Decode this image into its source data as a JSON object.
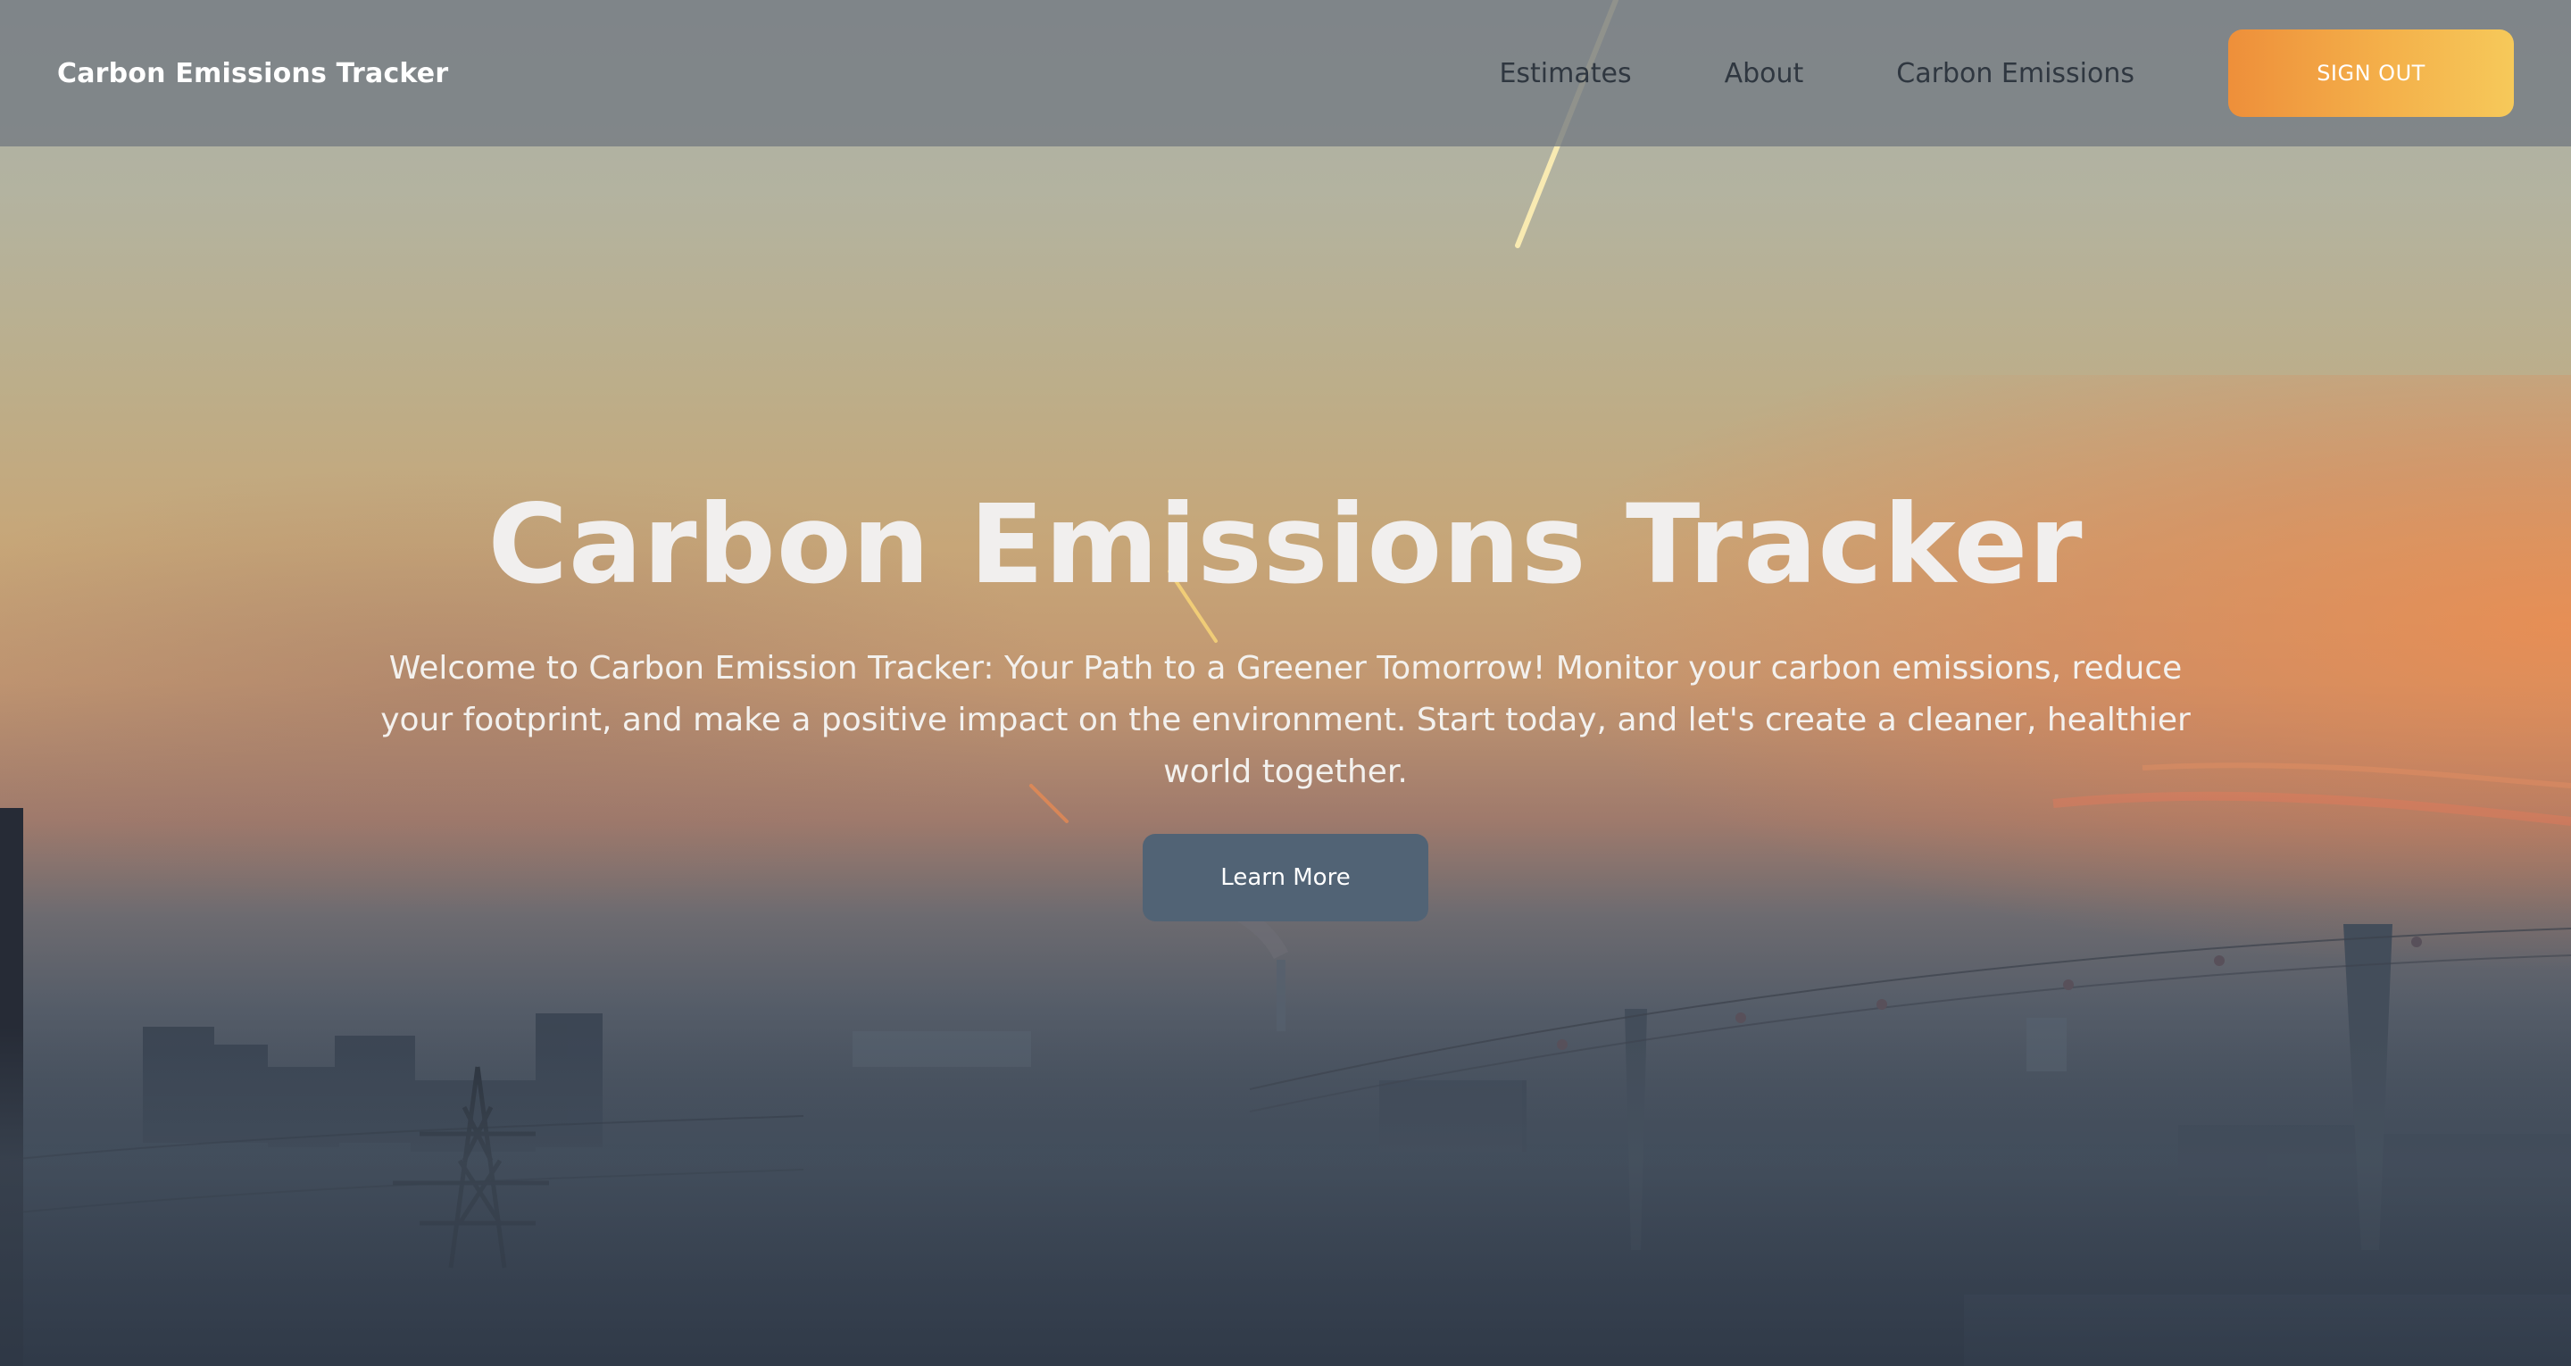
{
  "navbar": {
    "brand": "Carbon Emissions Tracker",
    "links": [
      {
        "label": "Estimates"
      },
      {
        "label": "About"
      },
      {
        "label": "Carbon Emissions"
      }
    ],
    "signout_label": "SIGN OUT"
  },
  "hero": {
    "title": "Carbon Emissions Tracker",
    "text": "Welcome to Carbon Emission Tracker: Your Path to a Greener Tomorrow! Monitor your carbon emissions, reduce your footprint, and make a positive impact on the environment. Start today, and let's create a cleaner, healthier world together.",
    "cta_label": "Learn More"
  },
  "colors": {
    "signout_gradient_start": "#ee8f3a",
    "signout_gradient_end": "#f6c95a",
    "learn_more_bg": "#516375",
    "navbar_bg": "#737a82"
  },
  "background": {
    "description_icon": "foggy-city-sunset-image"
  }
}
